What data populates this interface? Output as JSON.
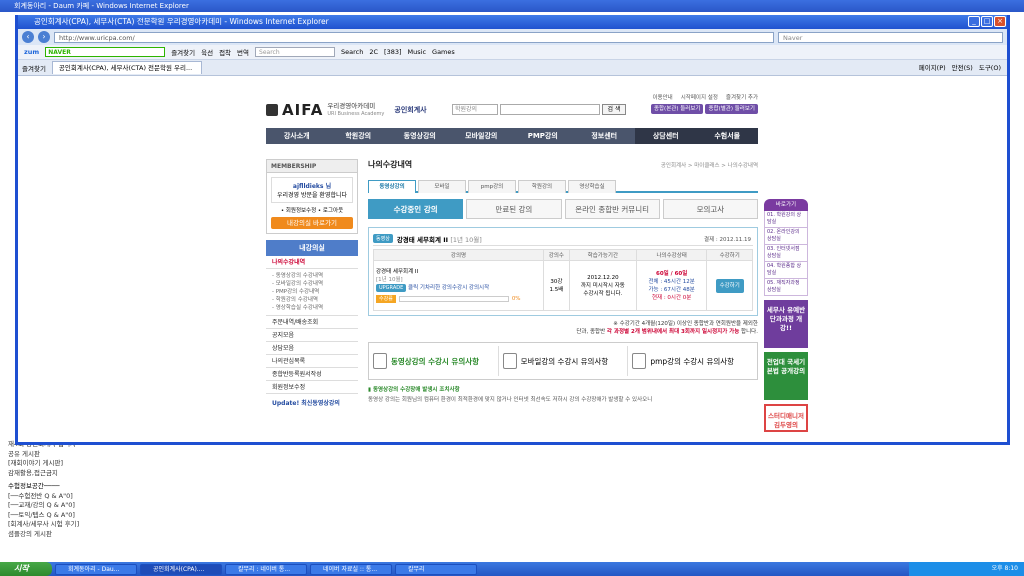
{
  "bg_window": {
    "title": "회계동아리 - Daum 카페 - Windows Internet Explorer",
    "left_items": [
      "재4회 공인회계사 합격자",
      "공유 게시판",
      "[재회이야기 게시판]",
      "감재활용,접근금지"
    ],
    "section_title": "수험정보공간────",
    "section_items": [
      "[──수험전반 Q & A\"0]",
      "[──교재/강의 Q & A\"0]",
      "[──토익/텝스 Q & A\"0]",
      "[회계사/세무사 시험 후기]",
      "셤플강의 게시판"
    ]
  },
  "ie": {
    "title": "공인회계사(CPA), 세무사(CTA) 전문학원 우리경영아카데미 - Windows Internet Explorer",
    "url": "http://www.uricpa.com/",
    "search_placeholder": "Naver",
    "search_box2": "Search",
    "zum_label": "zum",
    "naver_label": "NAVER",
    "toolbar": [
      "즐겨찾기",
      "육선",
      "접착",
      "번역",
      "Search",
      "2C",
      "[383]",
      "Music",
      "Games"
    ],
    "favorites": "즐겨찾기",
    "tab_title": "공인회계사(CPA), 세무사(CTA) 전문학원 우리...",
    "cmd": [
      "페이지(P)",
      "안전(S)",
      "도구(O)"
    ]
  },
  "site": {
    "top_links": [
      "이용안내",
      "시작페이지 설정",
      "즐겨찾기 추가"
    ],
    "logo": "AIFA",
    "logo_kr": "우리경영아카데미",
    "logo_en": "URI Business Academy",
    "category": "공인회계사",
    "search_select": "학원강의",
    "search_btn": "검 색",
    "quick": [
      "종합(본관) 둘러보기",
      "종합(별관) 둘러보기"
    ],
    "gnb": [
      "강사소개",
      "학원강의",
      "동영상강의",
      "모바일강의",
      "PMP강의",
      "정보센터",
      "상담센터",
      "수험서몰"
    ]
  },
  "lnb": {
    "membership": "MEMBERSHIP",
    "user": "ajflldieks 님",
    "user_msg": "우리경영 방문을 환영합니다",
    "links": "• 회원정보수정 • 로그아웃",
    "classroom_btn": "내강의실 바로가기",
    "my_title": "내강의실",
    "active_item": "나의수강내역",
    "sub_items": "- 동영상강의 수강내역\n- 모바일강의 수강내역\n- PMP강의 수강내역\n- 학원강의 수강내역\n- 영상학습실 수강내역",
    "items": [
      "주문내역/배송조회",
      "공지모음",
      "상담모음",
      "나의관심목록",
      "종합반등록원서작성",
      "회원정보수정"
    ],
    "update": "Update! 최신동영상강의"
  },
  "content": {
    "title": "나의수강내역",
    "breadcrumb": "공인회계사 > 마이클래스 > 나의수강내역",
    "tabs1": [
      "동영상강의",
      "모바일",
      "pmp강의",
      "학원강의",
      "영상학습실"
    ],
    "tabs2": [
      "수강중인 강의",
      "만료된 강의",
      "온라인 종합반 커뮤니티",
      "모의고사"
    ],
    "course_badge": "동영상",
    "course_name": "강경태 세무회계 II",
    "course_sub": "[1년 10월]",
    "course_date": "결제 : 2012.11.19",
    "table_headers": [
      "강의명",
      "강의수",
      "학습가능기간",
      "나의수강상태",
      "수강하기"
    ],
    "row": {
      "name": "강경태 세무회계 II",
      "name_sub": "[1년 10월]",
      "link_badge": "UPGRADE",
      "link_text": "클릭 기차리한 강의수강시 강의시작",
      "progress_label": "수강률",
      "progress_pct": "0%",
      "progress_value": 0,
      "count": "30강",
      "count2": "1.5배",
      "period": "2012.12.20",
      "period2": "까지 미시작시 자동",
      "period3": "수강시작 됩니다.",
      "days": "60일 / 60일",
      "status1": "전체 : 45시간 12분",
      "status2": "가능 : 67시간 48분",
      "status3": "현재 : 0시간 0분",
      "watch_btn": "수강하기"
    },
    "note1": "※ 수강기간 4개월(120일) 이상인 종합반과 연회원반을 제외한",
    "note2_a": "단과, 종합반 ",
    "note2_b": "각 과정별 2개 범위내에서 최대 3회까지 일시정지가 가능",
    "note2_c": " 합니다.",
    "notices": [
      "동영상강의 수강시 유의사항",
      "모바일강의 수강시 유의사항",
      "pmp강의 수강시 유의사항"
    ],
    "notice_sub": "▮ 동영상강의 수강장애 발생시 조치사항",
    "notice_text": "동영상 강의는 회원님의 컴퓨터 환경이 최적환경에 맞지 않거나 인터넷 최선속도 저하시 강의 수강장애가 발생할 수 있사오니"
  },
  "side": {
    "head": "바로가기",
    "items": [
      "01. 학원강의 상담실",
      "02. 온라인강의 상담실",
      "03. 인터넷서점 상담실",
      "04. 학원종합 상담실",
      "05. 재직자과정 상담실"
    ],
    "ads": [
      "세무사 유예반 단과과정 개강!!",
      "전업대 국세기본법 공개강의",
      "스터디매니저 김두영의"
    ]
  },
  "taskbar": {
    "start": "시작",
    "tasks": [
      "회계동아리 - Dau...",
      "공인회계사(CPA)....",
      "칼무리 : 네이버 통...",
      "네이버 자료실 :: 통...",
      "칼무리"
    ],
    "clock": "오후 8:10"
  }
}
